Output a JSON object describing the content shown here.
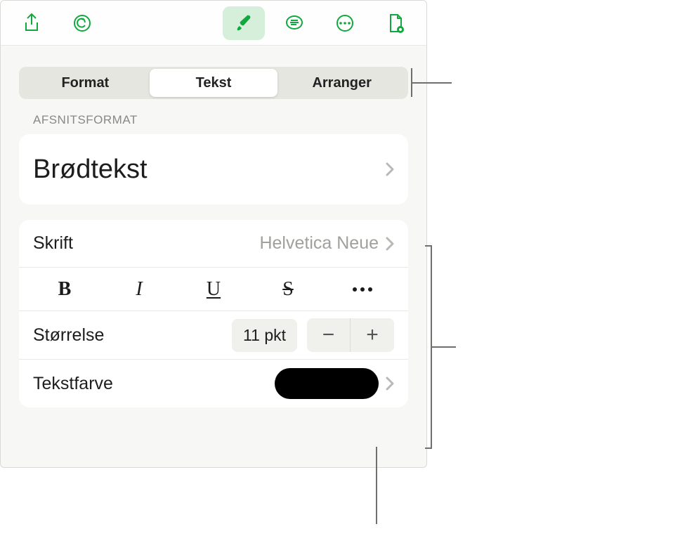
{
  "tabs": {
    "format": "Format",
    "text": "Tekst",
    "arrange": "Arranger"
  },
  "sections": {
    "paragraph_header": "AFSNITSFORMAT",
    "paragraph_style": "Brødtekst",
    "font_label": "Skrift",
    "font_value": "Helvetica Neue",
    "size_label": "Størrelse",
    "size_value": "11 pkt",
    "color_label": "Tekstfarve",
    "color_value": "#000000"
  },
  "style_buttons": {
    "bold": "B",
    "italic": "I",
    "underline": "U",
    "strike": "S"
  },
  "stepper": {
    "minus": "−",
    "plus": "+"
  }
}
